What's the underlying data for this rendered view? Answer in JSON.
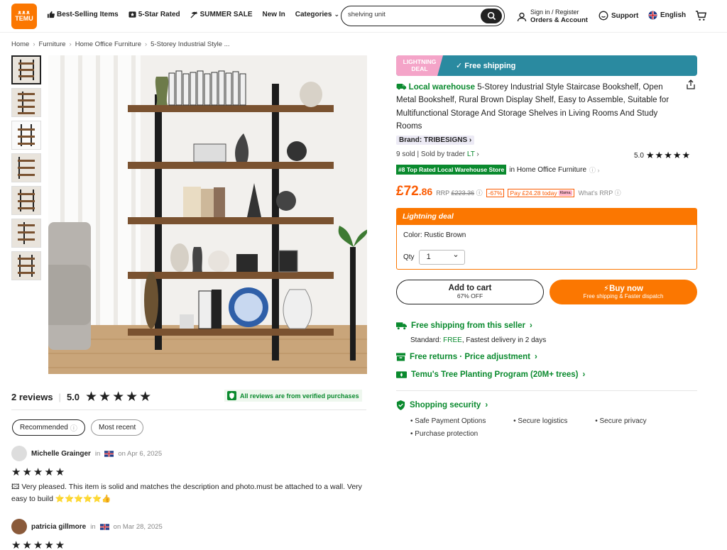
{
  "header": {
    "logo_line1": "ᴥᴥᴥ",
    "logo_line2": "TEMU",
    "nav": [
      {
        "label": "Best-Selling Items",
        "icon": "thumbs-up-icon"
      },
      {
        "label": "5-Star Rated",
        "icon": "star-badge-icon"
      },
      {
        "label": "SUMMER SALE",
        "icon": "beach-icon"
      },
      {
        "label": "New In",
        "icon": ""
      },
      {
        "label": "Categories",
        "icon": "chevron-down-icon"
      }
    ],
    "search_value": "shelving unit",
    "account_line1": "Sign in / Register",
    "account_line2": "Orders & Account",
    "support": "Support",
    "language": "English"
  },
  "breadcrumb": [
    "Home",
    "Furniture",
    "Home Office Furniture",
    "5-Storey Industrial Style ..."
  ],
  "product": {
    "banner_deal": "LIGHTNING",
    "banner_deal2": "DEAL",
    "banner_shipping": "Free shipping",
    "local_warehouse": "Local warehouse",
    "title": "5-Storey Industrial Style Staircase Bookshelf, Open Metal Bookshelf, Rural Brown Display Shelf, Easy to Assemble, Suitable for Multifunctional Storage And Storage Shelves in Living Rooms And Study Rooms",
    "brand": "Brand: TRIBESIGNS",
    "sold": "9 sold",
    "seller_prefix": "Sold by trader",
    "seller_tag": "LT",
    "rating_value": "5.0",
    "rating_stars": "★★★★★",
    "top_badge": "#8 Top Rated Local Warehouse Store",
    "top_badge_suffix": "in Home Office Furniture",
    "price_symbol": "£",
    "price_whole": "72",
    "price_decimal": ".86",
    "rrp_label": "RRP",
    "rrp_value": "£223.36",
    "discount": "-67%",
    "pay_today": "Pay £24.28 today",
    "klarna": "Klarna.",
    "whats_rrp": "What's RRP",
    "deal_header": "Lightning deal",
    "color_label": "Color: Rustic Brown",
    "qty_label": "Qty",
    "qty_value": "1",
    "cart_label": "Add to cart",
    "cart_sub": "67% OFF",
    "buy_label": "Buy now",
    "buy_sub": "Free shipping & Faster dispatch"
  },
  "services": {
    "shipping_title": "Free shipping from this seller",
    "shipping_sub_prefix": "Standard:",
    "shipping_sub_free": "FREE",
    "shipping_sub_rest": ", Fastest delivery in 2 days",
    "returns": "Free returns · Price adjustment",
    "tree": "Temu's Tree Planting Program (20M+ trees)",
    "security_title": "Shopping security",
    "security_items": [
      "Safe Payment Options",
      "Secure logistics",
      "Secure privacy",
      "Purchase protection"
    ]
  },
  "reviews": {
    "count_label": "2 reviews",
    "score": "5.0",
    "stars": "★★★★★",
    "verified": "All reviews are from verified purchases",
    "sort_options": [
      "Recommended",
      "Most recent"
    ],
    "items": [
      {
        "name": "Michelle Grainger",
        "in": "in",
        "date": "on Apr 6, 2025",
        "stars": "★★★★★",
        "text": "Very pleased. This item is solid and matches the description and photo.must be attached to a wall. Very easy to build ⭐⭐⭐⭐⭐👍"
      },
      {
        "name": "patricia gillmore",
        "in": "in",
        "date": "on Mar 28, 2025",
        "stars": "★★★★★",
        "text": ""
      }
    ]
  },
  "colors": {
    "accent": "#fb7701",
    "green": "#0a8a2e",
    "teal": "#2a8aa0"
  }
}
